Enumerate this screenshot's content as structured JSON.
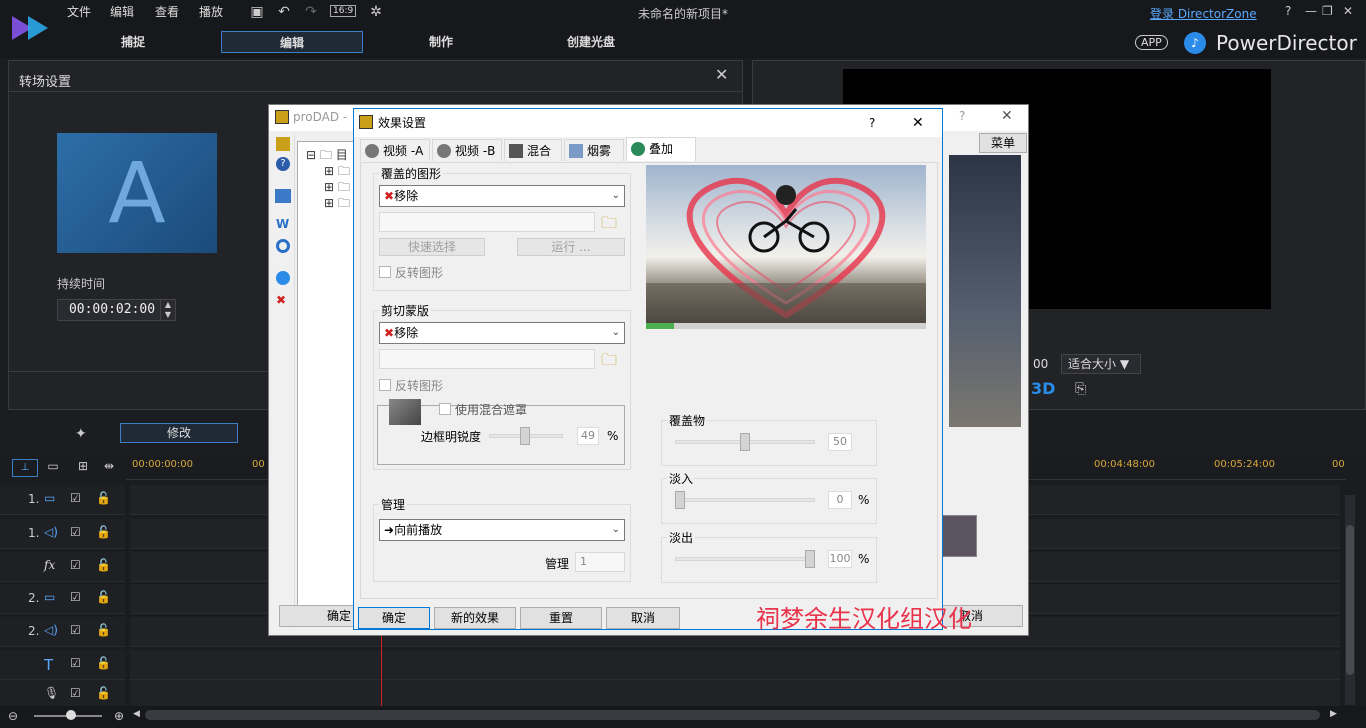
{
  "topbar": {
    "menus": [
      "文件",
      "编辑",
      "查看",
      "播放"
    ],
    "ratio": "16:9",
    "project_title": "未命名的新项目*",
    "login_link": "登录 DirectorZone",
    "window_controls": [
      "?",
      "—",
      "❐",
      "✕"
    ],
    "tabs": [
      "捕捉",
      "编辑",
      "制作",
      "创建光盘"
    ],
    "app_badge": "APP",
    "brand": "PowerDirector"
  },
  "transition_panel": {
    "title": "转场设置",
    "thumb_letter": "A",
    "duration_label": "持续时间",
    "duration_value": "00:00:02:00"
  },
  "preview": {
    "time_tail": "00",
    "fit_label": "适合大小",
    "mode_3d": "3D"
  },
  "edit_bar": {
    "modify_button": "修改"
  },
  "timeline": {
    "ruler": [
      "00:00:00:00",
      "00",
      "00:04:48:00",
      "00:05:24:00",
      "00"
    ],
    "tracks": [
      {
        "num": "1.",
        "type": "video-icon"
      },
      {
        "num": "1.",
        "type": "audio-icon"
      },
      {
        "num": "",
        "type": "fx"
      },
      {
        "num": "2.",
        "type": "video-icon"
      },
      {
        "num": "2.",
        "type": "audio-icon"
      },
      {
        "num": "",
        "type": "T"
      },
      {
        "num": "",
        "type": "mic-icon"
      }
    ],
    "fx_text": "fx",
    "title_text": "T"
  },
  "prodad": {
    "title": "proDAD -",
    "menu_button": "菜单",
    "ok_button": "确定",
    "cancel_button": "取消",
    "tree_root": "目"
  },
  "effects": {
    "title": "效果设置",
    "help": "?",
    "close": "✕",
    "tabs": [
      "视频 -A",
      "视频 -B",
      "混合",
      "烟雾",
      "叠加"
    ],
    "overlay_group": {
      "title": "覆盖的图形",
      "select_value": "移除",
      "quick_select": "快速选择",
      "run": "运行 ...",
      "invert": "反转图形"
    },
    "mask_group": {
      "title": "剪切蒙版",
      "select_value": "移除",
      "invert": "反转图形",
      "use_blend_mask": "使用混合遮罩",
      "edge_sharpness": "边框明锐度",
      "edge_value": "49",
      "percent": "%"
    },
    "manage_group": {
      "title": "管理",
      "select_value": "向前播放",
      "manage_label": "管理",
      "manage_value": "1"
    },
    "sliders": {
      "overlay": {
        "label": "覆盖物",
        "value": "50",
        "level": 50
      },
      "fade_in": {
        "label": "淡入",
        "value": "0",
        "unit": "%",
        "level": 0
      },
      "fade_out": {
        "label": "淡出",
        "value": "100",
        "unit": "%",
        "level": 100
      }
    },
    "buttons": {
      "ok": "确定",
      "new_effect": "新的效果",
      "reset": "重置",
      "cancel": "取消"
    },
    "watermark": "祠梦余生汉化组汉化",
    "accent_color": "#e8334a",
    "progress_color": "#4caf50"
  }
}
